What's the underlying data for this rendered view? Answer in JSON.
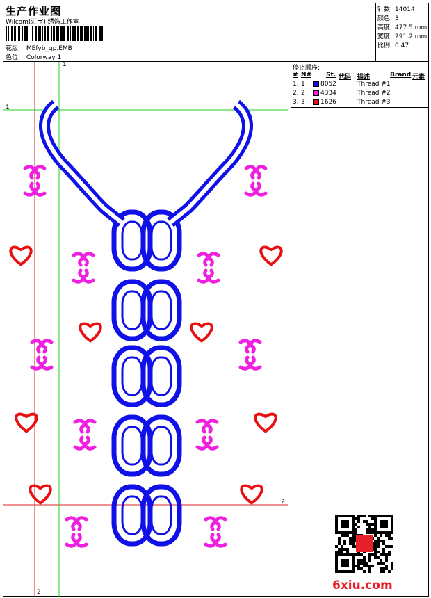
{
  "header": {
    "title": "生产作业图",
    "company": "Wilcom(汇宝) 绣饰工作室",
    "design_label": "花版:",
    "design_value": "MEfyb_gp.EMB",
    "colorway_label": "色位:",
    "colorway_value": "Colorway 1"
  },
  "stats": [
    {
      "label": "针数:",
      "value": "14014"
    },
    {
      "label": "颜色:",
      "value": "3"
    },
    {
      "label": "高度:",
      "value": "477.5 mm"
    },
    {
      "label": "宽度:",
      "value": "291.2 mm"
    },
    {
      "label": "比例:",
      "value": "0.47"
    }
  ],
  "stop_sequence": {
    "title": "停止顺序:",
    "columns": {
      "idx": "#",
      "no": "N#",
      "st": "St.",
      "code": "代码",
      "desc": "描述",
      "brand": "Brand",
      "elem": "元素"
    },
    "rows": [
      {
        "idx": "1.",
        "no": "1",
        "code": "8052",
        "desc": "Thread #1",
        "color": "#1010e8"
      },
      {
        "idx": "2.",
        "no": "2",
        "code": "4334",
        "desc": "Thread #2",
        "color": "#f020e0"
      },
      {
        "idx": "3.",
        "no": "3",
        "code": "1626",
        "desc": "Thread #3",
        "color": "#e81010"
      }
    ]
  },
  "guides": {
    "top_label": "1",
    "left_label": "1",
    "right_label": "2",
    "bottom_label": "2"
  },
  "watermark": {
    "text": "6xiu.com"
  },
  "colors": {
    "blue": "#1010e8",
    "magenta": "#f020e0",
    "red": "#e81010",
    "guide_red": "#e02020",
    "guide_green": "#20d020"
  }
}
